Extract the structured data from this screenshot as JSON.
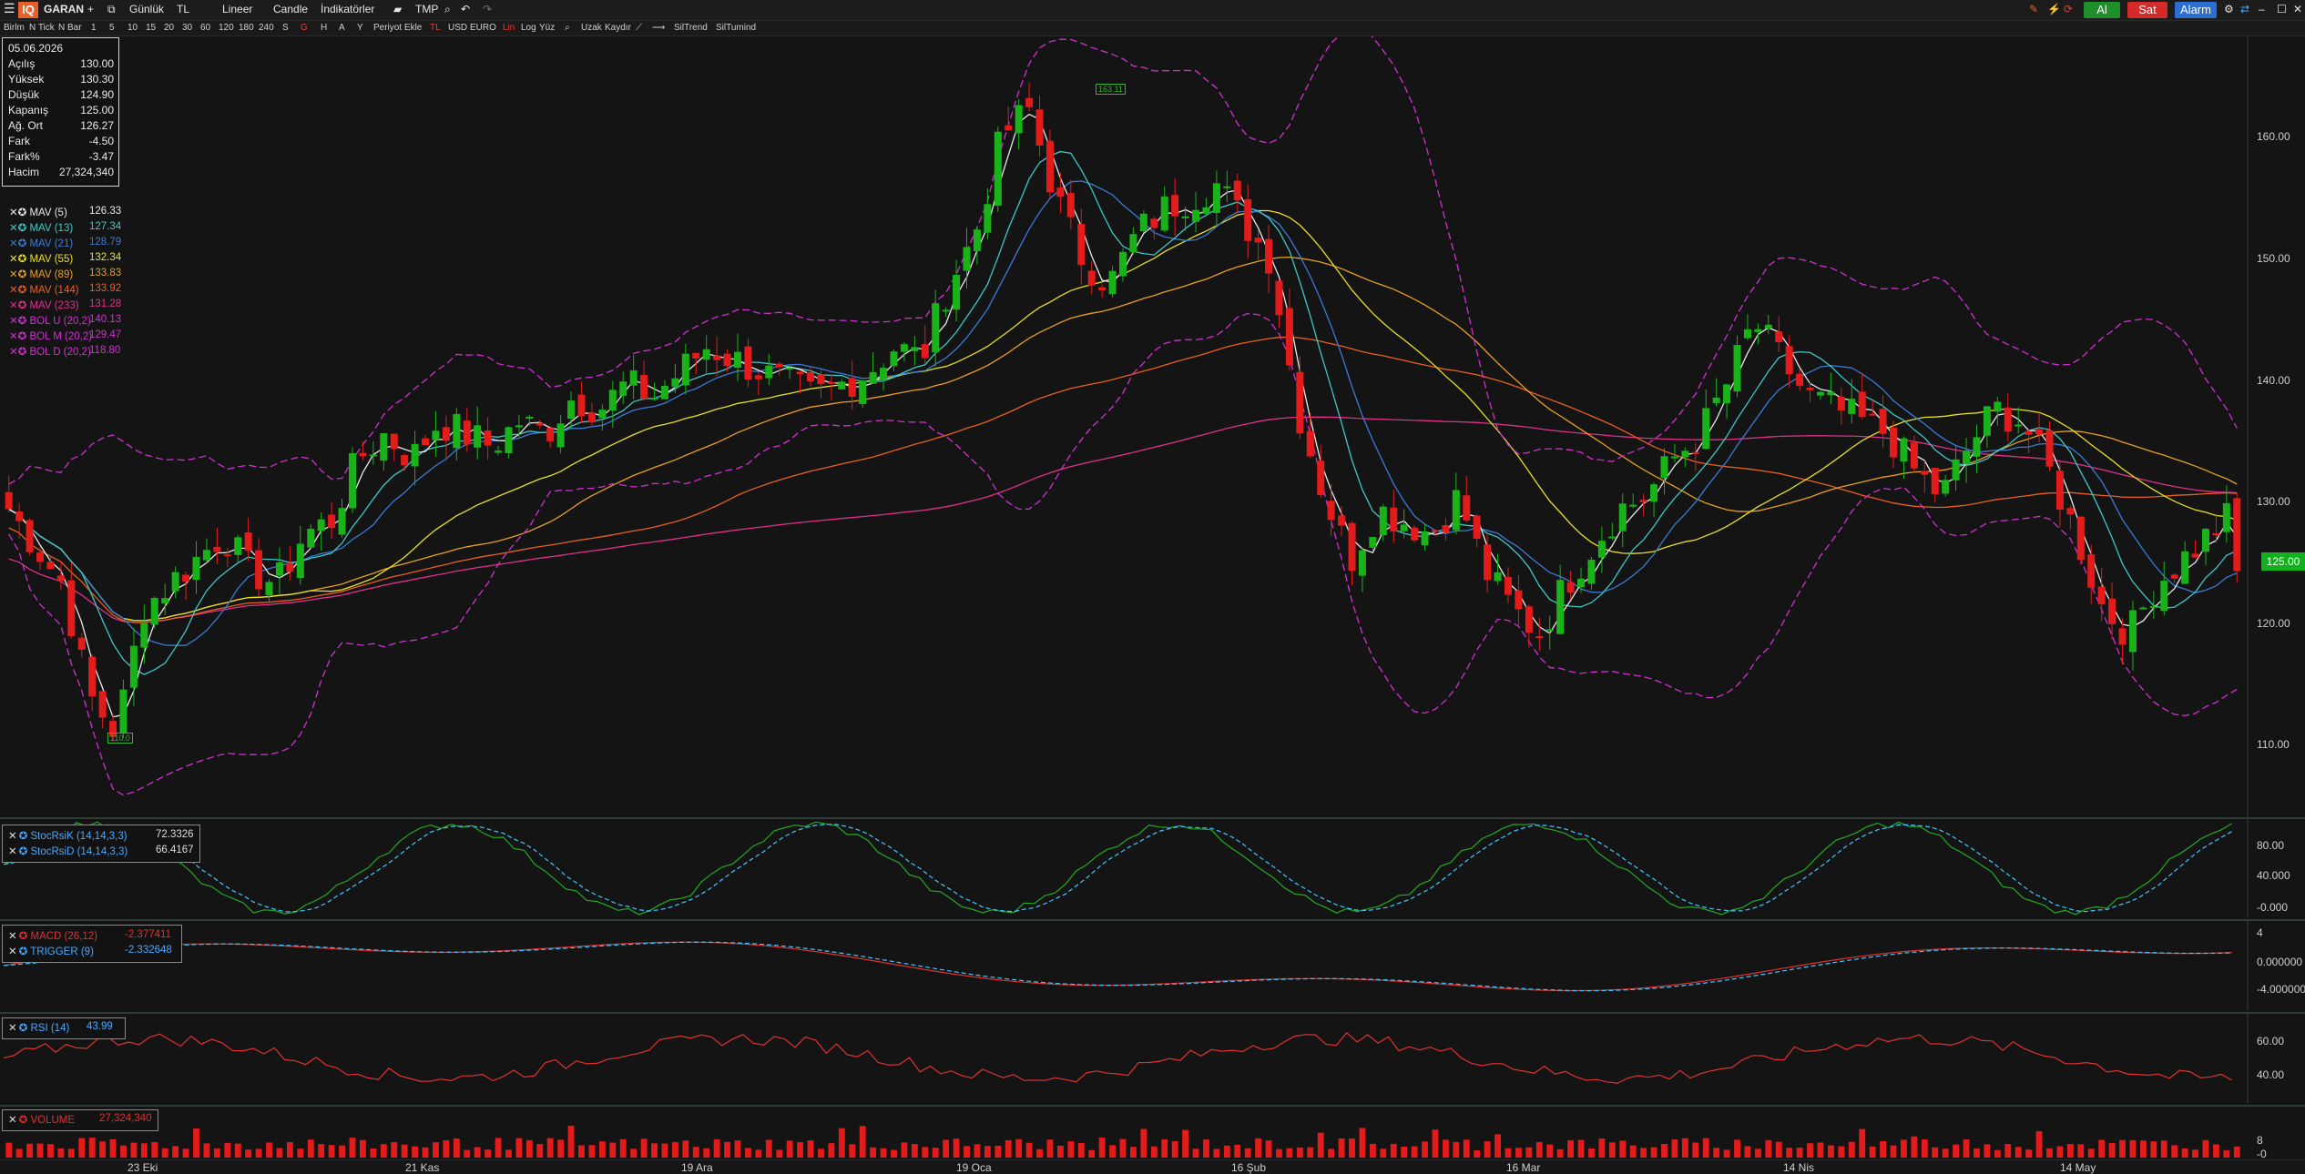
{
  "toolbar": {
    "symbol": "GARAN",
    "period": "Günlük",
    "currency": "TL",
    "scale": "Lineer",
    "chart_type": "Candle",
    "indicators": "İndikatörler",
    "tmp": "TMP",
    "buy": "Al",
    "sell": "Sat",
    "alarm": "Alarm",
    "colors": {
      "buy": "#1f8f2a",
      "sell": "#d42a2a",
      "alarm": "#2a6fd4",
      "logo": "#e8602a"
    }
  },
  "toolbar2": {
    "items": [
      "Birlm",
      "N Tick",
      "N Bar",
      "1",
      "5",
      "10",
      "15",
      "20",
      "30",
      "60",
      "120",
      "180",
      "240",
      "S",
      "G",
      "H",
      "A",
      "Y",
      "Periyot Ekle",
      "TL",
      "USD",
      "EURO",
      "Lin",
      "Log",
      "Yüz",
      "Uzak",
      "Kaydır",
      "SilTrend",
      "SilTumind"
    ]
  },
  "ohlc": {
    "date": "05.06.2026",
    "rows": [
      {
        "label": "Açılış",
        "value": "130.00"
      },
      {
        "label": "Yüksek",
        "value": "130.30"
      },
      {
        "label": "Düşük",
        "value": "124.90"
      },
      {
        "label": "Kapanış",
        "value": "125.00"
      },
      {
        "label": "Ağ. Ort",
        "value": "126.27"
      },
      {
        "label": "Fark",
        "value": "-4.50"
      },
      {
        "label": "Fark%",
        "value": "-3.47"
      },
      {
        "label": "Hacim",
        "value": "27,324,340"
      }
    ]
  },
  "overlays": [
    {
      "label": "MAV (5)",
      "value": "126.33",
      "color": "#e8e8e8"
    },
    {
      "label": "MAV (13)",
      "value": "127.34",
      "color": "#3fc7c7"
    },
    {
      "label": "MAV (21)",
      "value": "128.79",
      "color": "#3a7bd5"
    },
    {
      "label": "MAV (55)",
      "value": "132.34",
      "color": "#e8e020"
    },
    {
      "label": "MAV (89)",
      "value": "133.83",
      "color": "#e8a020"
    },
    {
      "label": "MAV (144)",
      "value": "133.92",
      "color": "#e86020"
    },
    {
      "label": "MAV (233)",
      "value": "131.28",
      "color": "#e0308a"
    },
    {
      "label": "BOL U (20,2)",
      "value": "140.13",
      "color": "#d030d0"
    },
    {
      "label": "BOL M (20,2)",
      "value": "129.47",
      "color": "#d030d0"
    },
    {
      "label": "BOL D (20,2)",
      "value": "118.80",
      "color": "#d030d0"
    }
  ],
  "price_axis": {
    "ticks": [
      "160.00",
      "150.00",
      "140.00",
      "130.00",
      "120.00",
      "110.00"
    ],
    "last": "125.00"
  },
  "markers": {
    "high": "163.11",
    "low": "110.0"
  },
  "date_axis": [
    "23 Eki",
    "21 Kas",
    "19 Ara",
    "19 Oca",
    "16 Şub",
    "16 Mar",
    "14 Nis",
    "14 May"
  ],
  "stoch": {
    "k_label": "StocRsiK (14,14,3,3)",
    "k_value": "72.3326",
    "d_label": "StocRsiD (14,14,3,3)",
    "d_value": "66.4167",
    "ticks": [
      "80.00",
      "40.000",
      "-0.000"
    ]
  },
  "macd": {
    "macd_label": "MACD (26,12)",
    "macd_value": "-2.377411",
    "trig_label": "TRIGGER (9)",
    "trig_value": "-2.332648",
    "ticks": [
      "4",
      "0.000000",
      "-4.000000"
    ]
  },
  "rsi": {
    "label": "RSI (14)",
    "value": "43.99",
    "ticks": [
      "60.00",
      "40.00"
    ]
  },
  "volume": {
    "label": "VOLUME",
    "value": "27,324,340",
    "ticks": [
      "8",
      "-0"
    ]
  },
  "chart_data": [
    {
      "type": "candlestick",
      "symbol": "GARAN",
      "ylim": [
        106,
        167
      ],
      "x": [
        "23 Eki",
        "21 Kas",
        "19 Ara",
        "19 Oca",
        "16 Şub",
        "16 Mar",
        "14 Nis",
        "14 May"
      ],
      "close_path": [
        130,
        127,
        124,
        115,
        112,
        122,
        124,
        126,
        128,
        125,
        124,
        128,
        129,
        134,
        136,
        134,
        137,
        136,
        135,
        137,
        136,
        139,
        138,
        140,
        139,
        141,
        143,
        142,
        141,
        140,
        139,
        140,
        141,
        143,
        142,
        148,
        152,
        160,
        162,
        155,
        150,
        148,
        152,
        154,
        155,
        156,
        153,
        150,
        138,
        131,
        126,
        130,
        129,
        128,
        131,
        125,
        122,
        120,
        124,
        127,
        130,
        131,
        134,
        136,
        140,
        145,
        142,
        139,
        138,
        137,
        136,
        133,
        131,
        135,
        138,
        137,
        133,
        128,
        122,
        120,
        124,
        126,
        128,
        130
      ],
      "last": 125.0
    },
    {
      "type": "line",
      "name": "StocRsi",
      "ylim": [
        0,
        100
      ]
    },
    {
      "type": "line",
      "name": "MACD",
      "ylim": [
        -5,
        5
      ]
    },
    {
      "type": "line",
      "name": "RSI",
      "ylim": [
        30,
        70
      ]
    },
    {
      "type": "bar",
      "name": "VOLUME"
    }
  ]
}
